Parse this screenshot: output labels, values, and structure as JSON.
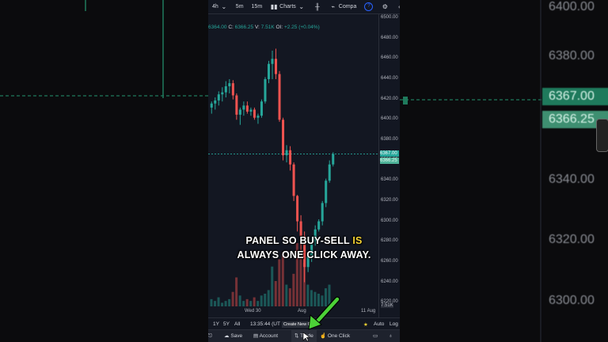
{
  "toolbar": {
    "interval": "4h",
    "quick_1": "5m",
    "quick_2": "15m",
    "charts_label": "Charts",
    "compare_label": "Compa",
    "icons": [
      "chevron-down-icon",
      "candles-icon",
      "indicator-icon",
      "help-icon",
      "gear-icon",
      "layers-icon",
      "more-icon"
    ]
  },
  "ohlc": {
    "open_value": "6364.00",
    "close_label": "C:",
    "close_value": "6366.25",
    "volume_label": "V:",
    "volume_value": "7.51K",
    "oi_label": "OI:",
    "change": "+2.25 (+0.04%)"
  },
  "price_axis": {
    "ticks": [
      "6500.00",
      "6480.00",
      "6460.00",
      "6440.00",
      "6420.00",
      "6400.00",
      "6380.00",
      "6360.00",
      "6340.00",
      "6320.00",
      "6300.00",
      "6280.00",
      "6260.00",
      "6240.00",
      "6220.00"
    ],
    "last_tag": "6367.00",
    "close_tag": "6366.25",
    "volume_tag": "7.51K",
    "ymin": 6210,
    "ymax": 6500
  },
  "time_axis": [
    "Wed 30",
    "Aug",
    "11 Aug"
  ],
  "bottom_bar": {
    "ranges": [
      "1Y",
      "5Y",
      "All"
    ],
    "clock": "13:35:44 (UT",
    "auto_label": "Auto",
    "log_label": "Log"
  },
  "tooltip": "Create New O",
  "trade_bar": {
    "save": "Save",
    "account": "Account",
    "trade": "Trade",
    "one_click": "One Click"
  },
  "caption": {
    "line1_a": "PANEL SO BUY-SELL ",
    "line1_b": "IS",
    "line2": "ALWAYS ONE CLICK AWAY."
  },
  "background_right": {
    "prices": [
      "6380.00",
      "6340.00",
      "6320.00",
      "6300.00"
    ],
    "tags": [
      "6367.00",
      "6366.25"
    ]
  },
  "colors": {
    "up": "#26a69a",
    "down": "#ef5350",
    "bg": "#131722",
    "arrow": "#4cd137"
  },
  "chart_data": {
    "type": "candlestick",
    "ohlc": [
      [
        6412,
        6418,
        6406,
        6416
      ],
      [
        6416,
        6422,
        6410,
        6419
      ],
      [
        6419,
        6428,
        6414,
        6425
      ],
      [
        6425,
        6432,
        6418,
        6427
      ],
      [
        6427,
        6438,
        6422,
        6433
      ],
      [
        6433,
        6440,
        6426,
        6436
      ],
      [
        6436,
        6439,
        6420,
        6424
      ],
      [
        6424,
        6426,
        6400,
        6405
      ],
      [
        6405,
        6412,
        6395,
        6410
      ],
      [
        6410,
        6418,
        6404,
        6414
      ],
      [
        6414,
        6418,
        6406,
        6408
      ],
      [
        6408,
        6412,
        6404,
        6410
      ],
      [
        6410,
        6412,
        6400,
        6402
      ],
      [
        6402,
        6406,
        6396,
        6404
      ],
      [
        6404,
        6420,
        6402,
        6418
      ],
      [
        6418,
        6442,
        6416,
        6440
      ],
      [
        6440,
        6458,
        6436,
        6455
      ],
      [
        6455,
        6468,
        6440,
        6460
      ],
      [
        6460,
        6470,
        6440,
        6445
      ],
      [
        6445,
        6448,
        6398,
        6400
      ],
      [
        6400,
        6402,
        6360,
        6365
      ],
      [
        6365,
        6375,
        6358,
        6370
      ],
      [
        6370,
        6374,
        6350,
        6356
      ],
      [
        6356,
        6358,
        6320,
        6325
      ],
      [
        6325,
        6326,
        6290,
        6300
      ],
      [
        6300,
        6306,
        6270,
        6285
      ],
      [
        6285,
        6290,
        6240,
        6255
      ],
      [
        6255,
        6270,
        6250,
        6265
      ],
      [
        6265,
        6285,
        6260,
        6280
      ],
      [
        6280,
        6296,
        6276,
        6292
      ],
      [
        6292,
        6302,
        6290,
        6300
      ],
      [
        6300,
        6320,
        6296,
        6318
      ],
      [
        6318,
        6342,
        6314,
        6340
      ],
      [
        6340,
        6360,
        6338,
        6356
      ],
      [
        6356,
        6368,
        6354,
        6366.25
      ]
    ],
    "volume": [
      4,
      3,
      5,
      2,
      3,
      4,
      8,
      16,
      6,
      3,
      4,
      3,
      5,
      3,
      6,
      7,
      9,
      22,
      14,
      26,
      30,
      12,
      10,
      18,
      35,
      28,
      24,
      12,
      9,
      8,
      7,
      6,
      10,
      12,
      3
    ]
  }
}
